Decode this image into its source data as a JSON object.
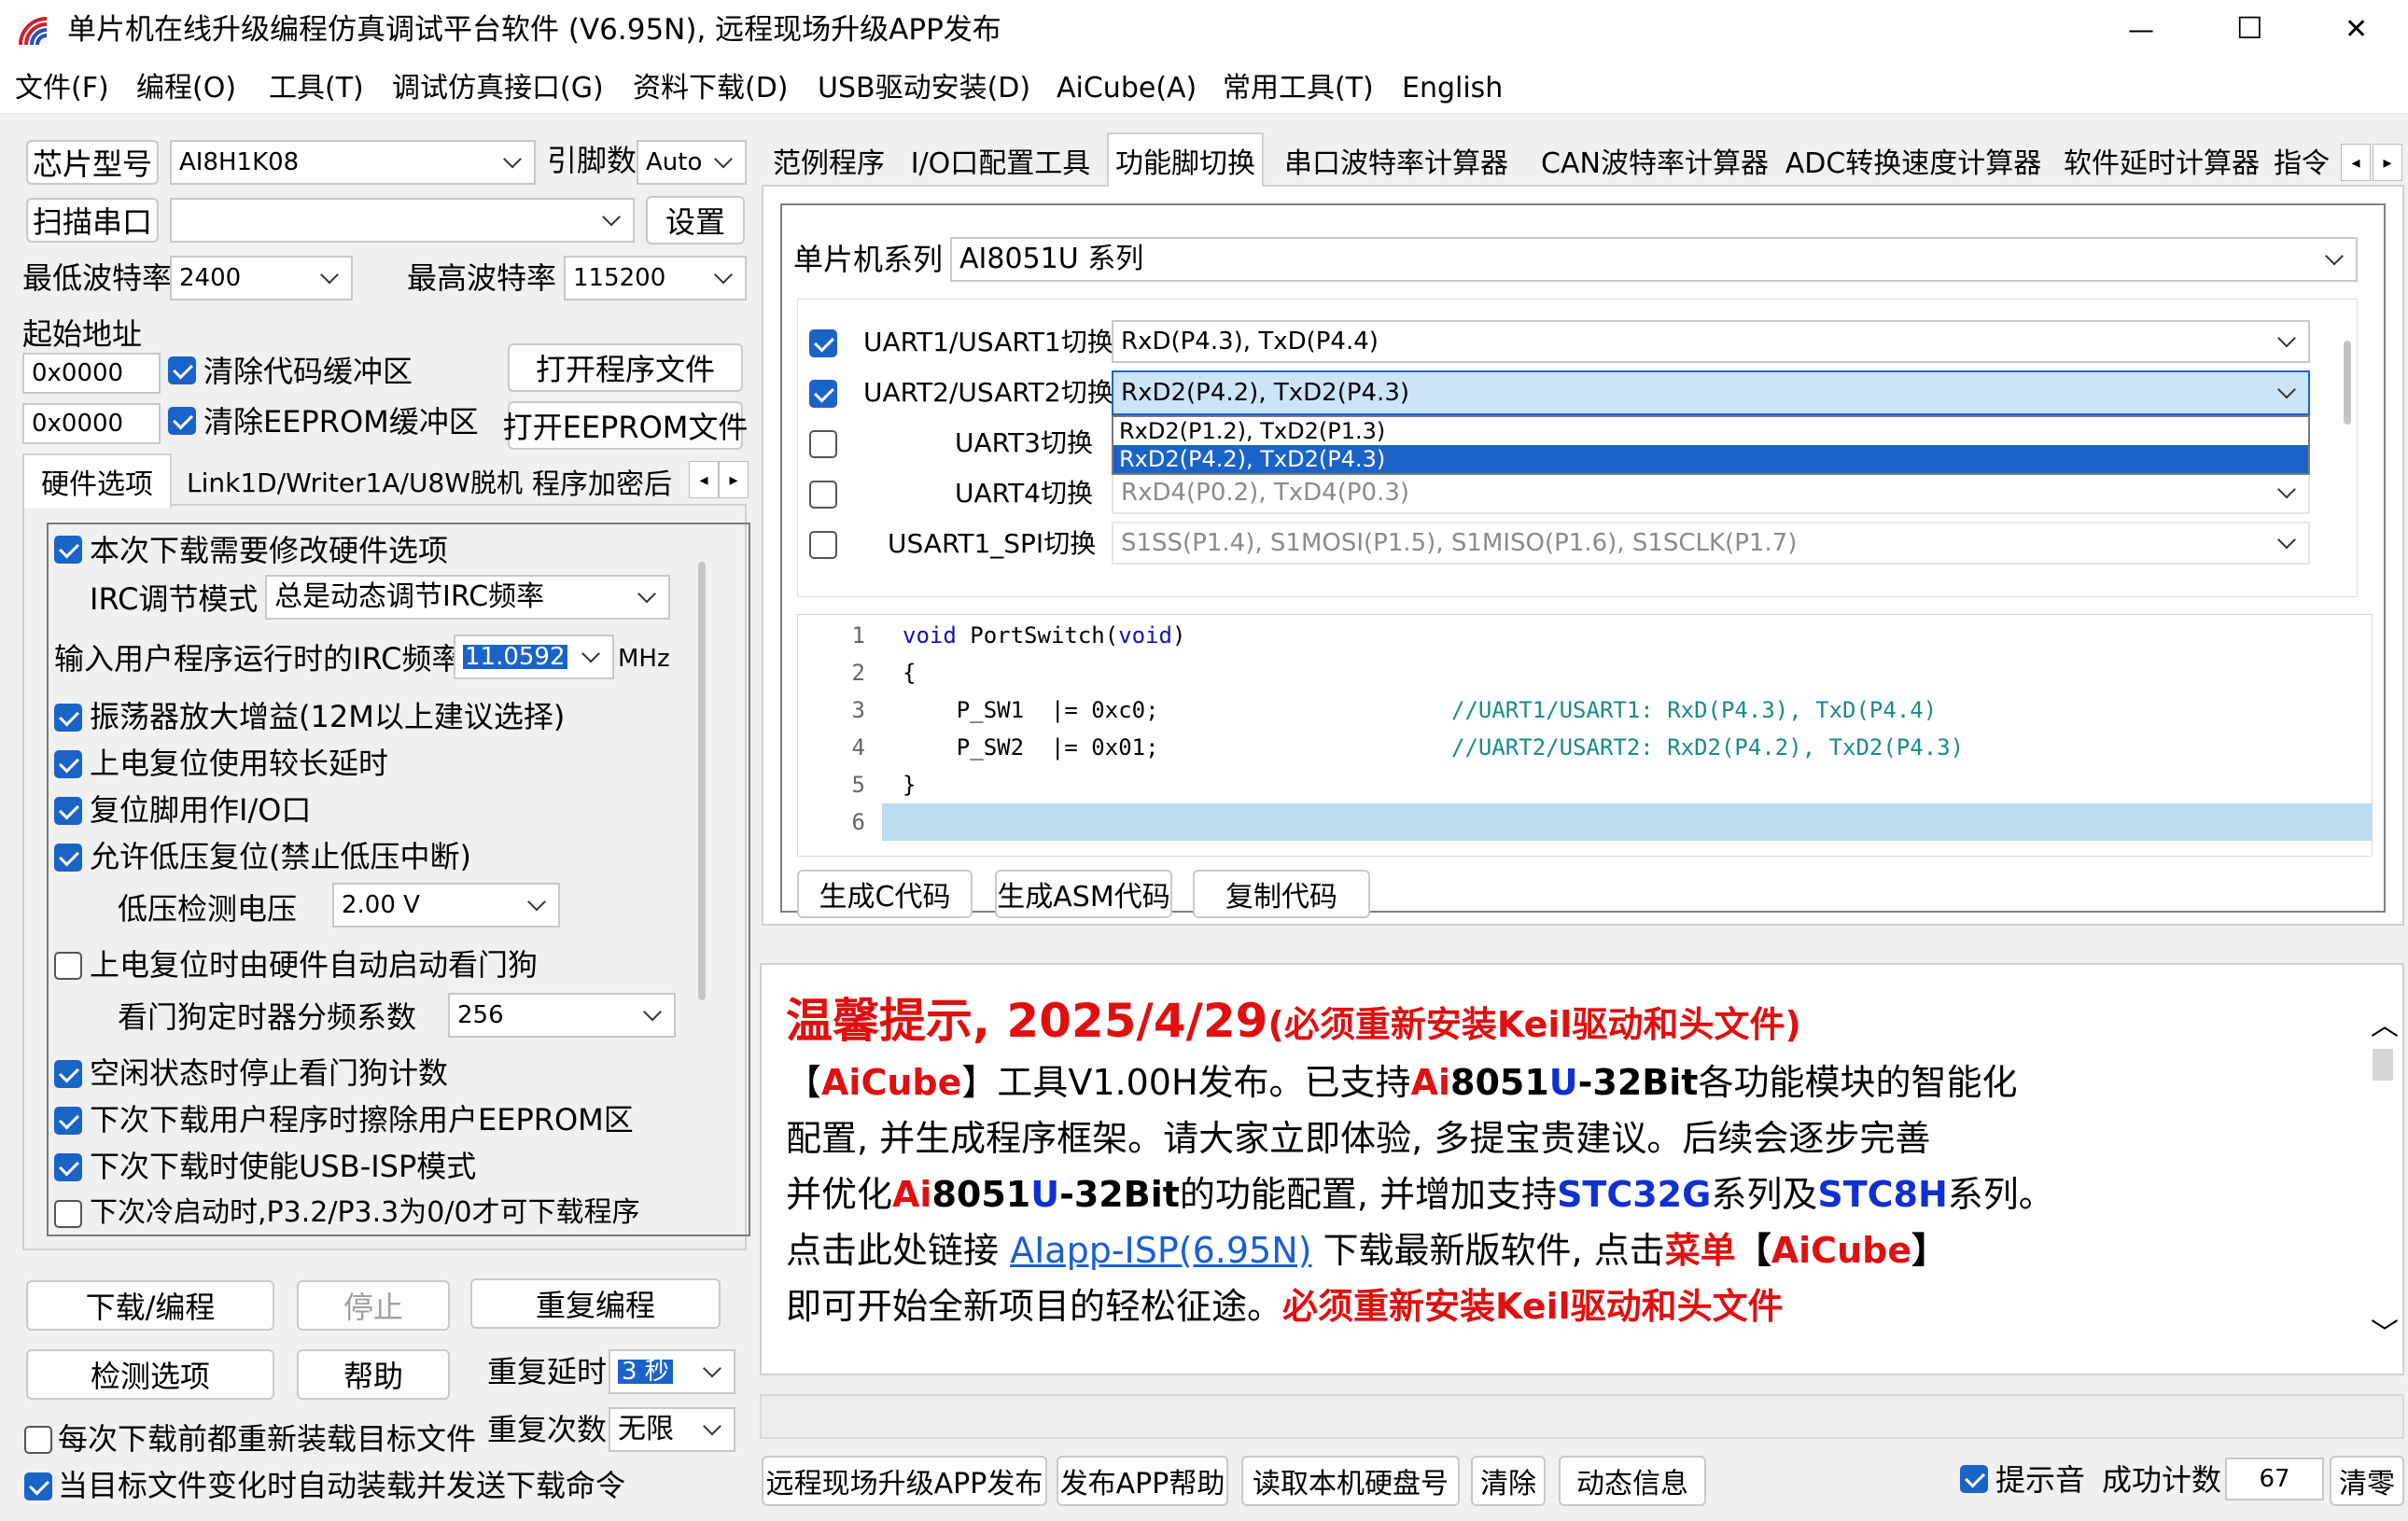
{
  "window": {
    "title": "单片机在线升级编程仿真调试平台软件 (V6.95N), 远程现场升级APP发布",
    "minimize": "—",
    "maximize": "☐",
    "close": "✕"
  },
  "menu": [
    "文件(F)",
    "编程(O)",
    "工具(T)",
    "调试仿真接口(G)",
    "资料下载(D)",
    "USB驱动安装(D)",
    "AiCube(A)",
    "常用工具(T)",
    "English"
  ],
  "left": {
    "chip_label": "芯片型号",
    "chip_value": "AI8H1K08",
    "pin_label": "引脚数",
    "pin_value": "Auto",
    "scan_label": "扫描串口",
    "scan_value": "",
    "settings_btn": "设置",
    "min_baud_label": "最低波特率",
    "min_baud_value": "2400",
    "max_baud_label": "最高波特率",
    "max_baud_value": "115200",
    "start_addr_label": "起始地址",
    "addr1": "0x0000",
    "clear_code_label": "清除代码缓冲区",
    "clear_code_checked": true,
    "open_prog_btn": "打开程序文件",
    "addr2": "0x0000",
    "clear_eeprom_label": "清除EEPROM缓冲区",
    "clear_eeprom_checked": true,
    "open_eeprom_btn": "打开EEPROM文件",
    "tabs": [
      "硬件选项",
      "Link1D/Writer1A/U8W脱机",
      "程序加密后"
    ],
    "options": [
      {
        "label": "本次下载需要修改硬件选项",
        "checked": true
      },
      {
        "label": "振荡器放大增益(12M以上建议选择)",
        "checked": true
      },
      {
        "label": "上电复位使用较长延时",
        "checked": true
      },
      {
        "label": "复位脚用作I/O口",
        "checked": true
      },
      {
        "label": "允许低压复位(禁止低压中断)",
        "checked": true
      },
      {
        "label": "上电复位时由硬件自动启动看门狗",
        "checked": false
      },
      {
        "label": "空闲状态时停止看门狗计数",
        "checked": true
      },
      {
        "label": "下次下载用户程序时擦除用户EEPROM区",
        "checked": true
      },
      {
        "label": "下次下载时使能USB-ISP模式",
        "checked": true
      },
      {
        "label": "下次冷启动时,P3.2/P3.3为0/0才可下载程序",
        "checked": false
      }
    ],
    "irc_mode_label": "IRC调节模式",
    "irc_mode_value": "总是动态调节IRC频率",
    "irc_freq_label": "输入用户程序运行时的IRC频率",
    "irc_freq_value": "11.0592",
    "irc_unit": "MHz",
    "lvd_label": "低压检测电压",
    "lvd_value": "2.00 V",
    "wdt_label": "看门狗定时器分频系数",
    "wdt_value": "256",
    "download_btn": "下载/编程",
    "stop_btn": "停止",
    "reprogram_btn": "重复编程",
    "check_btn": "检测选项",
    "help_btn": "帮助",
    "repeat_delay_label": "重复延时",
    "repeat_delay_value": "3 秒",
    "repeat_count_label": "重复次数",
    "repeat_count_value": "无限",
    "reload_label": "每次下载前都重新装载目标文件",
    "reload_checked": false,
    "auto_label": "当目标文件变化时自动装载并发送下载命令",
    "auto_checked": true
  },
  "right": {
    "tabs": [
      "范例程序",
      "I/O口配置工具",
      "功能脚切换",
      "串口波特率计算器",
      "CAN波特率计算器",
      "ADC转换速度计算器",
      "软件延时计算器",
      "指令"
    ],
    "active_tab": "功能脚切换",
    "series_label": "单片机系列",
    "series_value": "AI8051U 系列",
    "pins": [
      {
        "label": "UART1/USART1切换",
        "value": "RxD(P4.3), TxD(P4.4)",
        "checked": true
      },
      {
        "label": "UART2/USART2切换",
        "value": "RxD2(P4.2), TxD2(P4.3)",
        "checked": true
      },
      {
        "label": "UART3切换",
        "value": "",
        "checked": false
      },
      {
        "label": "UART4切换",
        "value": "RxD4(P0.2), TxD4(P0.3)",
        "checked": false
      },
      {
        "label": "USART1_SPI切换",
        "value": "S1SS(P1.4), S1MOSI(P1.5), S1MISO(P1.6), S1SCLK(P1.7)",
        "checked": false
      }
    ],
    "dropdown_options": [
      "RxD2(P1.2), TxD2(P1.3)",
      "RxD2(P4.2), TxD2(P4.3)"
    ],
    "code": [
      {
        "n": "1",
        "kw1": "void",
        "text": " PortSwitch(",
        "kw2": "void",
        "tail": ")",
        "comment": ""
      },
      {
        "n": "2",
        "kw1": "",
        "text": "{",
        "kw2": "",
        "tail": "",
        "comment": ""
      },
      {
        "n": "3",
        "kw1": "",
        "text": "    P_SW1  |= 0xc0;",
        "kw2": "",
        "tail": "",
        "comment": "//UART1/USART1: RxD(P4.3), TxD(P4.4)"
      },
      {
        "n": "4",
        "kw1": "",
        "text": "    P_SW2  |= 0x01;",
        "kw2": "",
        "tail": "",
        "comment": "//UART2/USART2: RxD2(P4.2), TxD2(P4.3)"
      },
      {
        "n": "5",
        "kw1": "",
        "text": "}",
        "kw2": "",
        "tail": "",
        "comment": ""
      },
      {
        "n": "6",
        "kw1": "",
        "text": "",
        "kw2": "",
        "tail": "",
        "comment": ""
      }
    ],
    "gen_c_btn": "生成C代码",
    "gen_asm_btn": "生成ASM代码",
    "copy_btn": "复制代码",
    "notice": {
      "heading_date": "温馨提示, 2025/4/29",
      "heading_note": "(必须重新安装Keil驱动和头文件)",
      "l1_a": "【",
      "l1_b": "AiCube",
      "l1_c": "】工具V1.00H发布。已支持",
      "l1_d": "Ai",
      "l1_e": "8051",
      "l1_f": "U",
      "l1_g": "-32Bit",
      "l1_h": "各功能模块的智能化",
      "l2": "配置, 并生成程序框架。请大家立即体验, 多提宝贵建议。后续会逐步完善",
      "l3_a": "并优化",
      "l3_b": "Ai",
      "l3_c": "8051",
      "l3_d": "U",
      "l3_e": "-32Bit",
      "l3_f": "的功能配置, 并增加支持",
      "l3_g": "STC32G",
      "l3_h": "系列及",
      "l3_i": "STC8H",
      "l3_j": "系列。",
      "l4_a": "点击此处链接 ",
      "l4_link": "AIapp-ISP(6.95N)",
      "l4_b": " 下载最新版软件, 点击",
      "l4_c": "菜单",
      "l4_d": "【",
      "l4_e": "AiCube",
      "l4_f": "】",
      "l5_a": "即可开始全新项目的轻松征途。",
      "l5_b": "必须重新安装Keil驱动和头文件"
    },
    "bottom_buttons": [
      "远程现场升级APP发布",
      "发布APP帮助",
      "读取本机硬盘号",
      "清除",
      "动态信息"
    ],
    "sound_label": "提示音",
    "sound_checked": true,
    "success_label": "成功计数",
    "success_value": "67",
    "clear_btn": "清零"
  }
}
